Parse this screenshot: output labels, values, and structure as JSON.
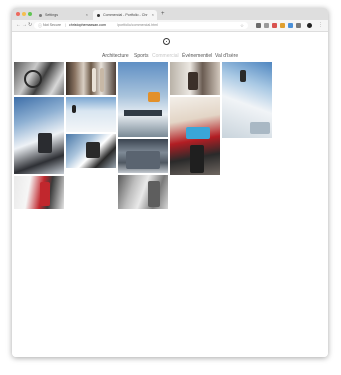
{
  "browser": {
    "tabs": [
      {
        "label": "Settings",
        "active": false
      },
      {
        "label": "Commercial - Portfolio - Chr",
        "active": true
      }
    ],
    "new_tab_label": "+",
    "close_label": "×",
    "nav": {
      "back": "←",
      "forward": "→",
      "reload": "↻"
    },
    "address": {
      "security_icon": "info-icon",
      "security_text": "Not Secure",
      "separator": "|",
      "host": "christophemaxsan.com",
      "path": "/portfolio/commercial.html",
      "star": "☆"
    },
    "extensions_menu": "⋮"
  },
  "site": {
    "nav": [
      {
        "label": "Architecture",
        "current": false
      },
      {
        "label": "Sports",
        "current": false
      },
      {
        "label": "Commercial",
        "current": true
      },
      {
        "label": "Événementiel",
        "current": false
      },
      {
        "label": "Val d'Isère",
        "current": false
      }
    ]
  },
  "colors": {
    "accent_red": "#c1272d",
    "nav_text": "#555555",
    "nav_current": "#c8c8c8"
  },
  "gallery": [
    {
      "name": "photo-ski-bindings"
    },
    {
      "name": "photo-workshop-skis"
    },
    {
      "name": "photo-skier-jump-orange"
    },
    {
      "name": "photo-ski-shop-interior"
    },
    {
      "name": "photo-freerider-powder"
    },
    {
      "name": "photo-skier-deep-snow"
    },
    {
      "name": "photo-skier-slope"
    },
    {
      "name": "photo-skier-portrait"
    },
    {
      "name": "photo-chalet-night"
    },
    {
      "name": "photo-red-ski-boot"
    },
    {
      "name": "photo-skier-red-jacket"
    },
    {
      "name": "photo-building-facade"
    }
  ]
}
